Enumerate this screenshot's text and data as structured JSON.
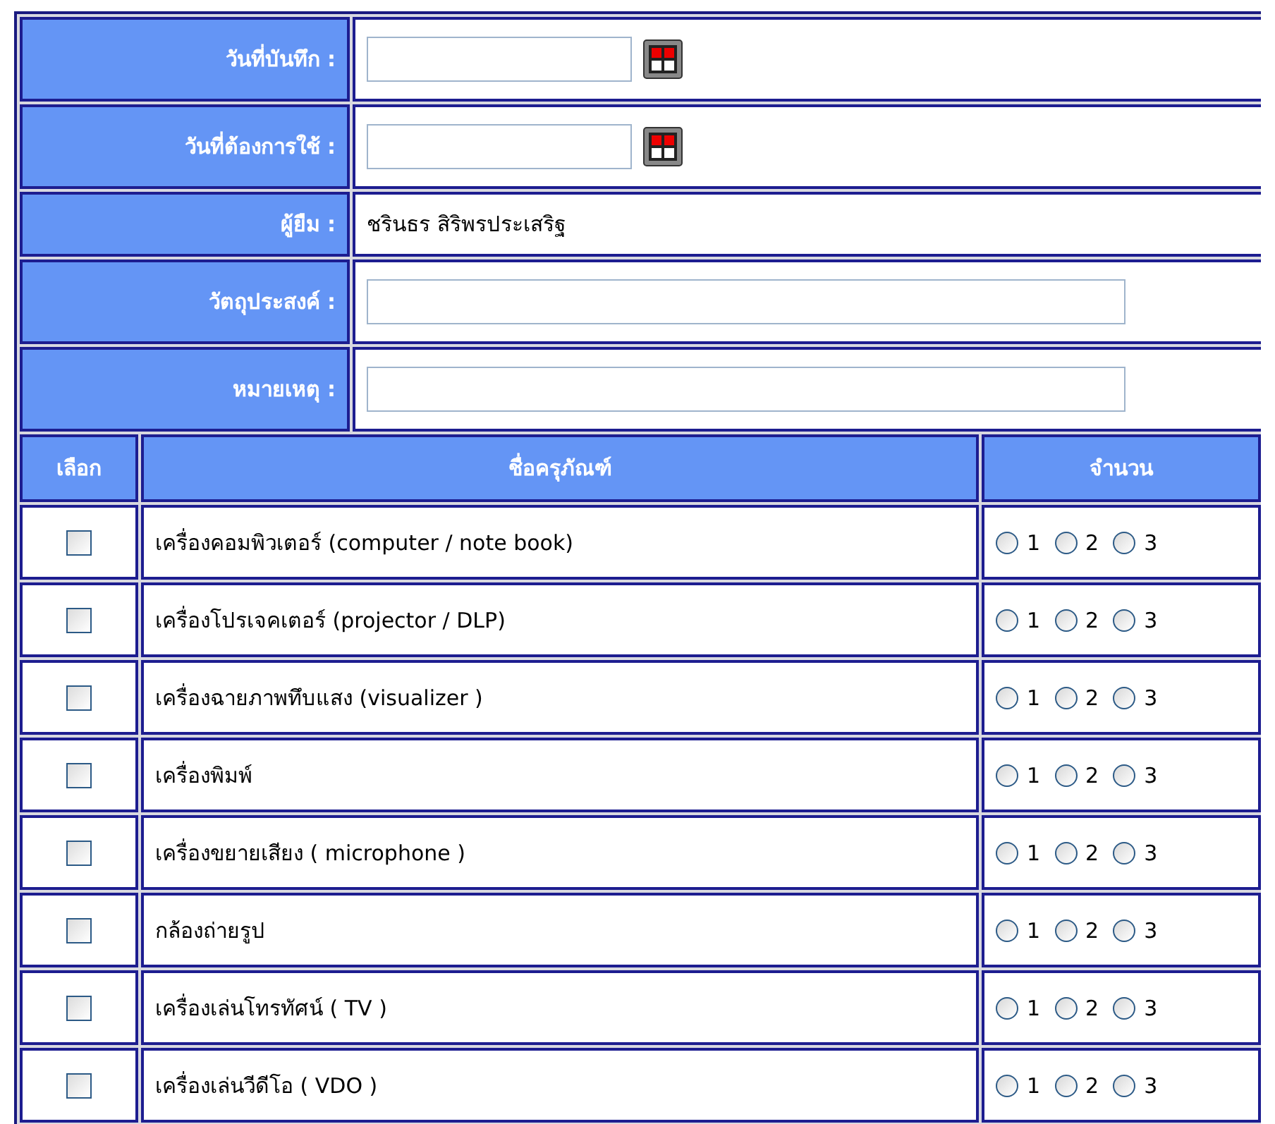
{
  "form": [
    {
      "label": "วันที่บันทึก :",
      "kind": "date"
    },
    {
      "label": "วันที่ต้องการใช้ :",
      "kind": "date"
    },
    {
      "label": "ผู้ยืม :",
      "kind": "text",
      "value": "ชรินธร สิริพรประเสริฐ"
    },
    {
      "label": "วัตถุประสงค์ :",
      "kind": "input"
    },
    {
      "label": "หมายเหตุ :",
      "kind": "input"
    }
  ],
  "table": {
    "columns": [
      "เลือก",
      "ชื่อครุภัณฑ์",
      "จำนวน"
    ],
    "rows": [
      {
        "checked": false,
        "name": "เครื่องคอมพิวเตอร์ (computer / note book)",
        "options": [
          {
            "label": "1",
            "selected": false
          },
          {
            "label": "2",
            "selected": false
          },
          {
            "label": "3",
            "selected": false
          }
        ]
      },
      {
        "checked": false,
        "name": "เครื่องโปรเจคเตอร์ (projector / DLP)",
        "options": [
          {
            "label": "1",
            "selected": false
          },
          {
            "label": "2",
            "selected": false
          },
          {
            "label": "3",
            "selected": false
          }
        ]
      },
      {
        "checked": false,
        "name": "เครื่องฉายภาพทึบแสง (visualizer )",
        "options": [
          {
            "label": "1",
            "selected": false
          },
          {
            "label": "2",
            "selected": false
          },
          {
            "label": "3",
            "selected": false
          }
        ]
      },
      {
        "checked": false,
        "name": "เครื่องพิมพ์",
        "options": [
          {
            "label": "1",
            "selected": false
          },
          {
            "label": "2",
            "selected": false
          },
          {
            "label": "3",
            "selected": false
          }
        ]
      },
      {
        "checked": false,
        "name": "เครื่องขยายเสียง ( microphone )",
        "options": [
          {
            "label": "1",
            "selected": false
          },
          {
            "label": "2",
            "selected": false
          },
          {
            "label": "3",
            "selected": false
          }
        ]
      },
      {
        "checked": false,
        "name": "กล้องถ่ายรูป",
        "options": [
          {
            "label": "1",
            "selected": false
          },
          {
            "label": "2",
            "selected": false
          },
          {
            "label": "3",
            "selected": false
          }
        ]
      },
      {
        "checked": false,
        "name": "เครื่องเล่นโทรทัศน์ ( TV )",
        "options": [
          {
            "label": "1",
            "selected": false
          },
          {
            "label": "2",
            "selected": false
          },
          {
            "label": "3",
            "selected": false
          }
        ]
      },
      {
        "checked": false,
        "name": "เครื่องเล่นวีดีโอ ( VDO )",
        "options": [
          {
            "label": "1",
            "selected": false
          },
          {
            "label": "2",
            "selected": false
          },
          {
            "label": "3",
            "selected": false
          }
        ]
      }
    ]
  }
}
